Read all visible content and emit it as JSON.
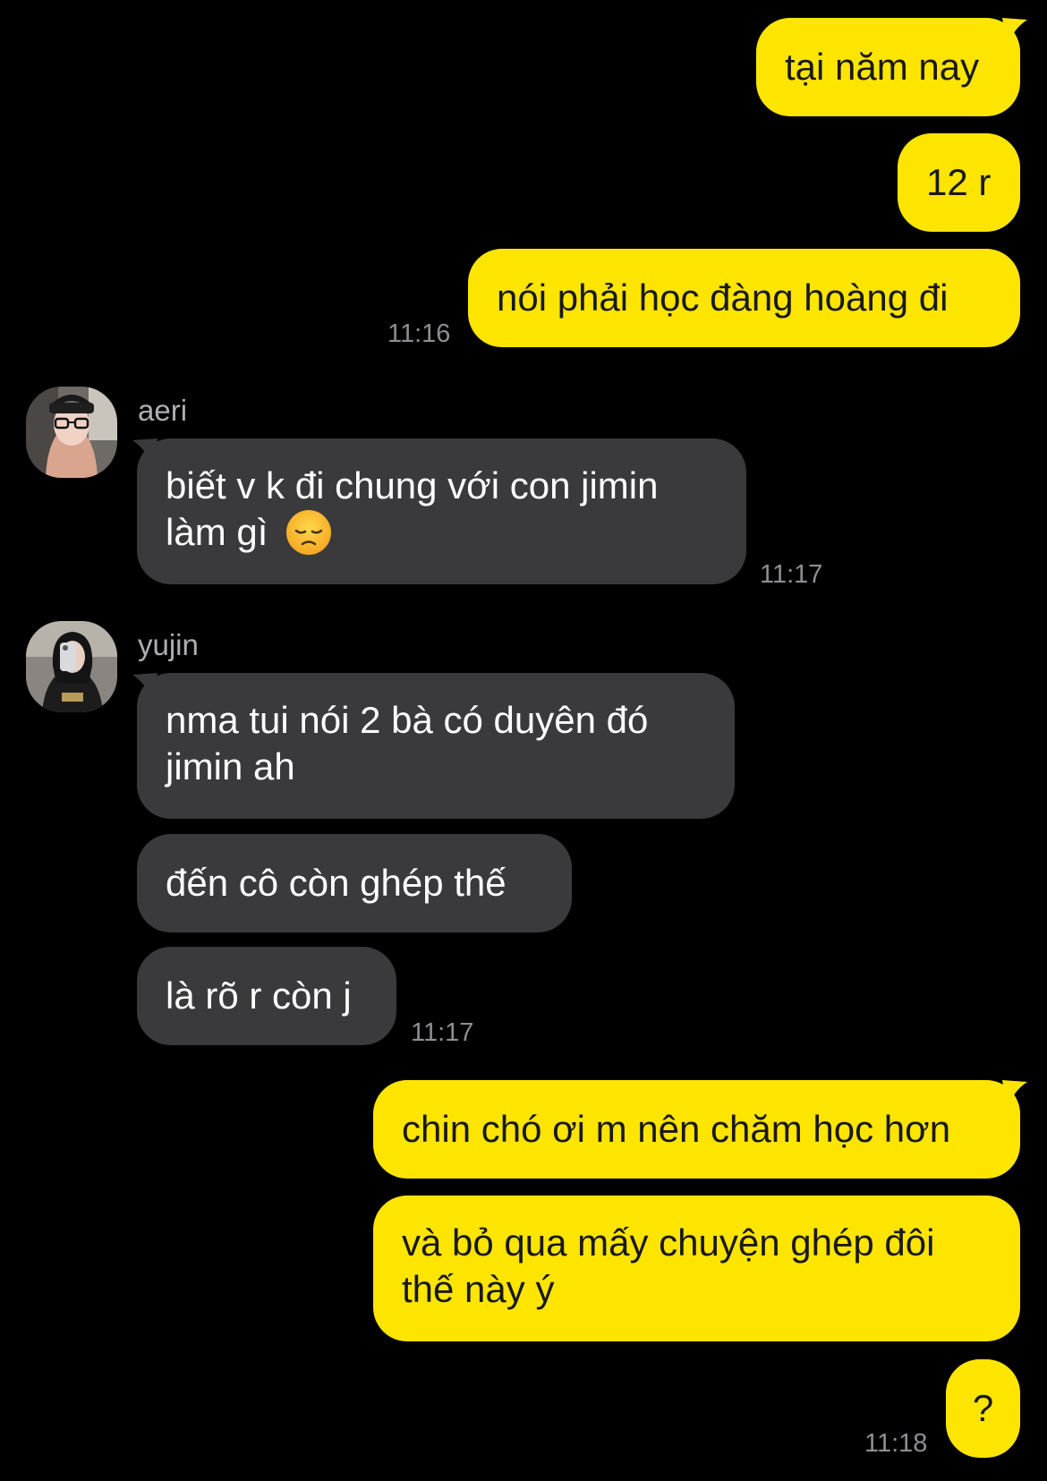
{
  "colors": {
    "background": "#000000",
    "outgoing_bubble": "#FEE500",
    "incoming_bubble": "#3a3a3c",
    "outgoing_text": "#191919",
    "incoming_text": "#ffffff",
    "timestamp": "#8e8e93"
  },
  "messages": {
    "out1": {
      "text": "tại năm nay"
    },
    "out2": {
      "text": "12 r"
    },
    "out3": {
      "text": "nói phải học đàng hoàng đi",
      "time": "11:16"
    },
    "aeri": {
      "sender": "aeri",
      "avatar_icon": "aeri-avatar-photo",
      "msg1": {
        "line1": "biết v k đi chung với con jimin",
        "line2": "làm gì",
        "emoji": "disappointed-face-icon",
        "time": "11:17"
      }
    },
    "yujin": {
      "sender": "yujin",
      "avatar_icon": "yujin-avatar-photo",
      "msg1": {
        "line1": "nma tui nói 2 bà có duyên đó",
        "line2": "jimin ah"
      },
      "msg2": {
        "text": "đến cô còn ghép thế"
      },
      "msg3": {
        "text": "là rõ r còn j",
        "time": "11:17"
      }
    },
    "out4": {
      "text": "chin chó ơi m nên chăm học hơn"
    },
    "out5": {
      "line1": "và bỏ qua mấy chuyện ghép đôi",
      "line2": "thế này ý"
    },
    "out6": {
      "text": "?",
      "time": "11:18"
    }
  }
}
